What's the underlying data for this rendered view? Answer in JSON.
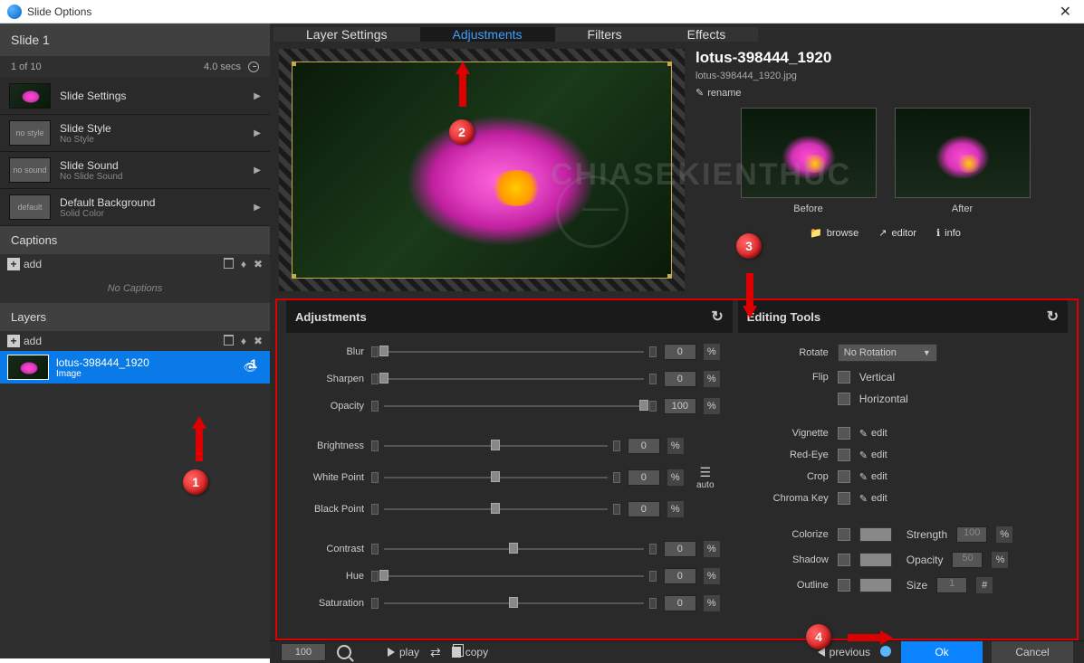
{
  "window": {
    "title": "Slide Options"
  },
  "sidebar": {
    "slide_title": "Slide 1",
    "position": "1 of 10",
    "duration": "4.0 secs",
    "items": [
      {
        "thumb": "flower",
        "title": "Slide Settings",
        "sub": ""
      },
      {
        "thumb": "no style",
        "title": "Slide Style",
        "sub": "No Style"
      },
      {
        "thumb": "no sound",
        "title": "Slide Sound",
        "sub": "No Slide Sound"
      },
      {
        "thumb": "default",
        "title": "Default Background",
        "sub": "Solid Color"
      }
    ],
    "captions": {
      "header": "Captions",
      "add": "add",
      "empty": "No Captions"
    },
    "layers": {
      "header": "Layers",
      "add": "add",
      "items": [
        {
          "name": "lotus-398444_1920",
          "type": "Image"
        }
      ]
    }
  },
  "tabs": [
    "Layer Settings",
    "Adjustments",
    "Filters",
    "Effects"
  ],
  "active_tab": 1,
  "image": {
    "name": "lotus-398444_1920",
    "filename": "lotus-398444_1920.jpg",
    "rename": "rename",
    "before": "Before",
    "after": "After",
    "actions": {
      "browse": "browse",
      "editor": "editor",
      "info": "info"
    }
  },
  "adjustments": {
    "title": "Adjustments",
    "rows": [
      {
        "label": "Blur",
        "value": "0",
        "pos": 0,
        "unit": "%"
      },
      {
        "label": "Sharpen",
        "value": "0",
        "pos": 0,
        "unit": "%"
      },
      {
        "label": "Opacity",
        "value": "100",
        "pos": 100,
        "unit": "%"
      }
    ],
    "rows2": [
      {
        "label": "Brightness",
        "value": "0",
        "pos": 50,
        "unit": "%"
      },
      {
        "label": "White Point",
        "value": "0",
        "pos": 50,
        "unit": "%"
      },
      {
        "label": "Black Point",
        "value": "0",
        "pos": 50,
        "unit": "%"
      }
    ],
    "auto": "auto",
    "rows3": [
      {
        "label": "Contrast",
        "value": "0",
        "pos": 50,
        "unit": "%"
      },
      {
        "label": "Hue",
        "value": "0",
        "pos": 0,
        "unit": "%"
      },
      {
        "label": "Saturation",
        "value": "0",
        "pos": 50,
        "unit": "%"
      }
    ]
  },
  "editing": {
    "title": "Editing Tools",
    "rotate": {
      "label": "Rotate",
      "value": "No Rotation"
    },
    "flip": {
      "label": "Flip",
      "vertical": "Vertical",
      "horizontal": "Horizontal"
    },
    "toggles": [
      {
        "label": "Vignette",
        "edit": "edit"
      },
      {
        "label": "Red-Eye",
        "edit": "edit"
      },
      {
        "label": "Crop",
        "edit": "edit"
      },
      {
        "label": "Chroma Key",
        "edit": "edit"
      }
    ],
    "colorize": {
      "label": "Colorize",
      "strength_label": "Strength",
      "strength": "100",
      "unit": "%"
    },
    "shadow": {
      "label": "Shadow",
      "opacity_label": "Opacity",
      "opacity": "50",
      "unit": "%"
    },
    "outline": {
      "label": "Outline",
      "size_label": "Size",
      "size": "1",
      "unit": "#"
    }
  },
  "footer": {
    "zoom": "100",
    "play": "play",
    "copy": "copy",
    "previous": "previous",
    "ok": "Ok",
    "cancel": "Cancel"
  },
  "markers": {
    "m1": "1",
    "m2": "2",
    "m3": "3",
    "m4": "4"
  }
}
